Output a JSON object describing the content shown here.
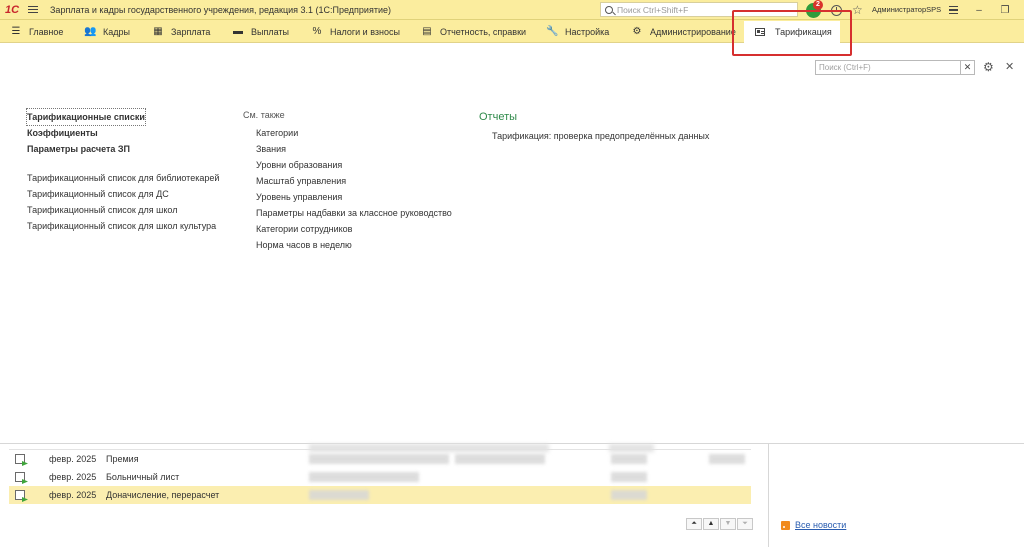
{
  "titlebar": {
    "logo": "1С",
    "title": "Зарплата и кадры государственного учреждения, редакция 3.1  (1С:Предприятие)",
    "search_placeholder": "Поиск Ctrl+Shift+F",
    "notifications_count": "2",
    "user": "АдминистраторSPS"
  },
  "sections": [
    {
      "label": "Главное",
      "icon": "menu-icon"
    },
    {
      "label": "Кадры",
      "icon": "people-icon"
    },
    {
      "label": "Зарплата",
      "icon": "calculator-icon"
    },
    {
      "label": "Выплаты",
      "icon": "wallet-icon"
    },
    {
      "label": "Налоги и взносы",
      "icon": "percent-icon"
    },
    {
      "label": "Отчетность, справки",
      "icon": "report-icon"
    },
    {
      "label": "Настройка",
      "icon": "wrench-icon"
    },
    {
      "label": "Администрирование",
      "icon": "gear-icon"
    }
  ],
  "active_section": {
    "label": "Тарификация",
    "icon": "card-icon"
  },
  "panel": {
    "search_placeholder": "Поиск (Ctrl+F)",
    "main_links": [
      "Тарификационные списки",
      "Коэффициенты",
      "Параметры расчета ЗП"
    ],
    "list_links": [
      "Тарификационный список для библиотекарей",
      "Тарификационный список для ДС",
      "Тарификационный список для школ",
      "Тарификационный список для школ культура"
    ],
    "see_also_heading": "См. также",
    "see_also": [
      "Категории",
      "Звания",
      "Уровни образования",
      "Масштаб управления",
      "Уровень управления",
      "Параметры надбавки за классное руководство",
      "Категории сотрудников",
      "Норма часов в неделю"
    ],
    "reports_heading": "Отчеты",
    "reports": [
      "Тарификация: проверка предопределённых данных"
    ]
  },
  "documents": [
    {
      "date": "февр. 2025",
      "name": "Премия",
      "selected": false
    },
    {
      "date": "февр. 2025",
      "name": "Больничный лист",
      "selected": false
    },
    {
      "date": "февр. 2025",
      "name": "Доначисление, перерасчет",
      "selected": true
    }
  ],
  "news_link": "Все новости"
}
